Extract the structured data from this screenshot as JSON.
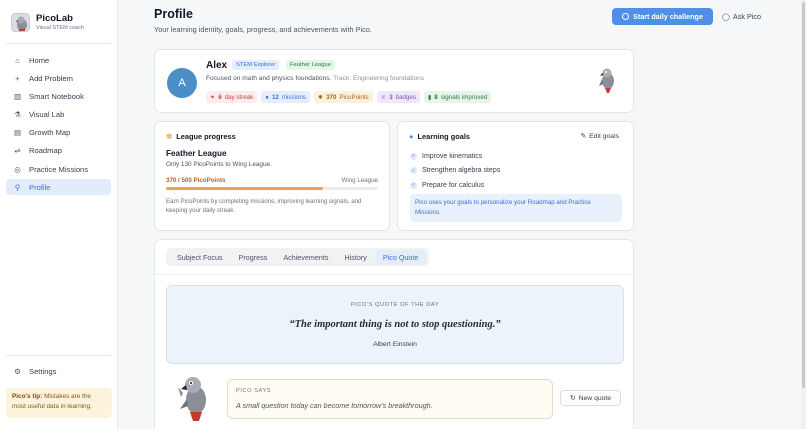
{
  "brand": {
    "name": "PicoLab",
    "tagline": "Visual STEM coach"
  },
  "nav": {
    "items": [
      {
        "label": "Home",
        "icon": "home-icon"
      },
      {
        "label": "Add Problem",
        "icon": "plus-icon"
      },
      {
        "label": "Smart Notebook",
        "icon": "book-icon"
      },
      {
        "label": "Visual Lab",
        "icon": "flask-icon"
      },
      {
        "label": "Growth Map",
        "icon": "map-icon"
      },
      {
        "label": "Roadmap",
        "icon": "roadmap-icon"
      },
      {
        "label": "Practice Missions",
        "icon": "target-icon"
      },
      {
        "label": "Profile",
        "icon": "user-icon",
        "active": true
      }
    ],
    "settings": "Settings"
  },
  "tip": {
    "label": "Pico's tip:",
    "text": "Mistakes are the most useful data in learning."
  },
  "header": {
    "title": "Profile",
    "subtitle": "Your learning identity, goals, progress, and achievements with Pico.",
    "primary_button": "Start daily challenge",
    "ask_button": "Ask Pico"
  },
  "profile": {
    "initial": "A",
    "name": "Alex",
    "badges": [
      "STEM Explorer",
      "Feather League"
    ],
    "focus": "Focused on math and physics foundations.",
    "track": "Track: Engineering foundations",
    "stats": [
      {
        "value": "6",
        "label": "day streak"
      },
      {
        "value": "12",
        "label": "missions"
      },
      {
        "value": "370",
        "label": "PicoPoints"
      },
      {
        "value": "3",
        "label": "badges"
      },
      {
        "value": "8",
        "label": "signals improved"
      }
    ]
  },
  "league": {
    "heading": "League progress",
    "name": "Feather League",
    "subtitle": "Only 130 PicoPoints to Wing League.",
    "points_text": "370 / 500 PicoPoints",
    "next_league": "Wing League",
    "progress": 0.74,
    "note": "Earn PicoPoints by completing missions, improving learning signals, and keeping your daily streak."
  },
  "goals": {
    "heading": "Learning goals",
    "edit_label": "Edit goals",
    "items": [
      "Improve kinematics",
      "Strengthen algebra steps",
      "Prepare for calculus"
    ],
    "note": "Pico uses your goals to personalize your Roadmap and Practice Missions."
  },
  "tabs": {
    "items": [
      "Subject Focus",
      "Progress",
      "Achievements",
      "History",
      "Pico Quote"
    ],
    "active": 4
  },
  "quote": {
    "label": "PICO'S QUOTE OF THE DAY",
    "text": "“The important thing is not to stop questioning.”",
    "author": "Albert Einstein"
  },
  "pico": {
    "label": "PICO SAYS",
    "text": "A small question today can become tomorrow’s breakthrough.",
    "button": "New quote"
  },
  "colors": {
    "accent": "#4f8fe8",
    "active_nav_bg": "#e3ecfb",
    "progress": "#e8a54a"
  }
}
